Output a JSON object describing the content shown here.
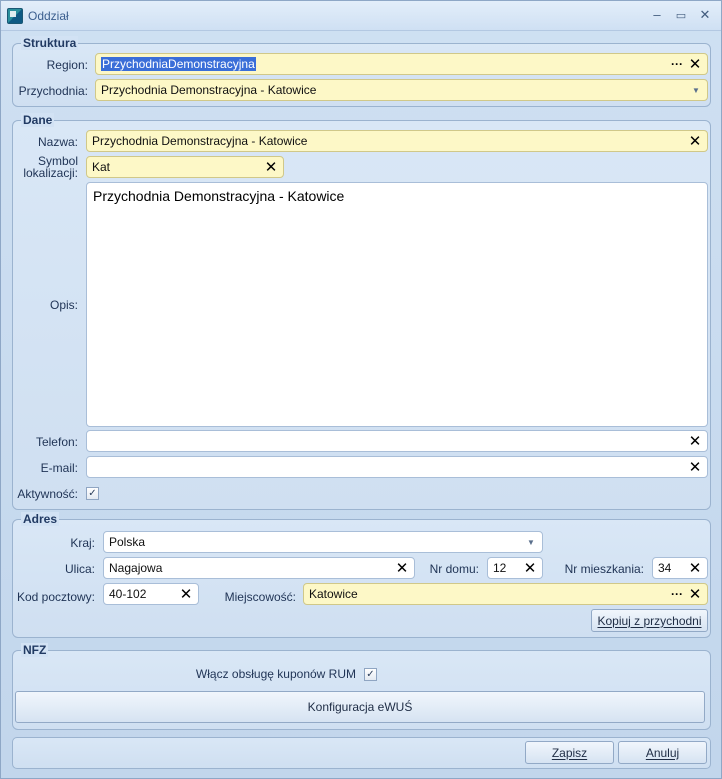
{
  "window": {
    "title": "Oddział"
  },
  "struktura": {
    "title": "Struktura",
    "region_label": "Region:",
    "region_value": "PrzychodniaDemonstracyjna",
    "przychodnia_label": "Przychodnia:",
    "przychodnia_value": "Przychodnia Demonstracyjna - Katowice"
  },
  "dane": {
    "title": "Dane",
    "nazwa_label": "Nazwa:",
    "nazwa_value": "Przychodnia Demonstracyjna - Katowice",
    "symbol_label_1": "Symbol",
    "symbol_label_2": "lokalizacji:",
    "symbol_value": "Kat",
    "opis_label": "Opis:",
    "opis_value": "Przychodnia Demonstracyjna - Katowice",
    "telefon_label": "Telefon:",
    "telefon_value": "",
    "email_label": "E-mail:",
    "email_value": "",
    "aktywnosc_label": "Aktywność:",
    "aktywnosc_checked": true
  },
  "adres": {
    "title": "Adres",
    "kraj_label": "Kraj:",
    "kraj_value": "Polska",
    "ulica_label": "Ulica:",
    "ulica_value": "Nagajowa",
    "nr_domu_label": "Nr domu:",
    "nr_domu_value": "12",
    "nr_mieszkania_label": "Nr mieszkania:",
    "nr_mieszkania_value": "34",
    "kod_label": "Kod pocztowy:",
    "kod_value": "40-102",
    "miejscowosc_label": "Miejscowość:",
    "miejscowosc_value": "Katowice",
    "kopiuj_label": "Kopiuj z przychodni"
  },
  "nfz": {
    "title": "NFZ",
    "rum_label": "Włącz obsługę kuponów RUM",
    "rum_checked": true,
    "ewus_label": "Konfiguracja eWUŚ"
  },
  "footer": {
    "zapisz_label": "Zapisz",
    "anuluj_label": "Anuluj"
  },
  "icons": {
    "clear": "close-icon",
    "ellipsis": "ellipsis-icon",
    "dropdown": "chevron-down-icon",
    "check": "check-icon"
  },
  "colors": {
    "required_field_bg": "#fdf8c7",
    "selection": "#3a6ed8",
    "window_bg": "#c4d7ec"
  }
}
